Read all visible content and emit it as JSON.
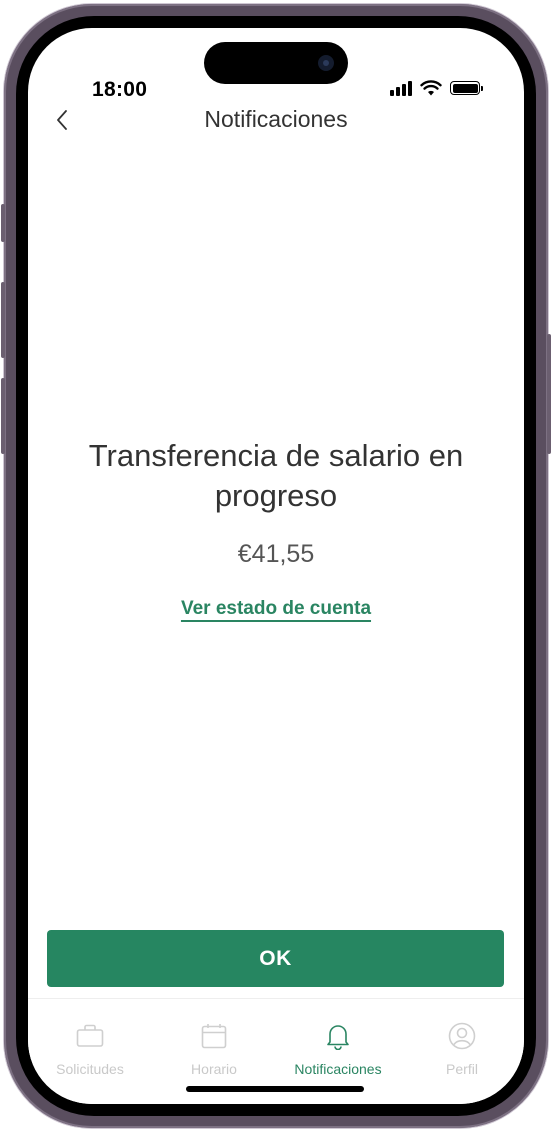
{
  "status_bar": {
    "time": "18:00"
  },
  "header": {
    "title": "Notificaciones",
    "back_icon": "chevron-left-icon"
  },
  "notification": {
    "title": "Transferencia de salario en progreso",
    "amount": "€41,55",
    "link_label": "Ver estado de cuenta"
  },
  "primary_button": {
    "label": "OK"
  },
  "tab_bar": {
    "items": [
      {
        "label": "Solicitudes",
        "icon": "briefcase-icon",
        "active": false
      },
      {
        "label": "Horario",
        "icon": "calendar-icon",
        "active": false
      },
      {
        "label": "Notificaciones",
        "icon": "bell-icon",
        "active": true
      },
      {
        "label": "Perfil",
        "icon": "profile-icon",
        "active": false
      }
    ]
  },
  "colors": {
    "accent": "#268661",
    "link": "#2a8562",
    "inactive_tab": "#c9c9c9",
    "text": "#333333"
  }
}
